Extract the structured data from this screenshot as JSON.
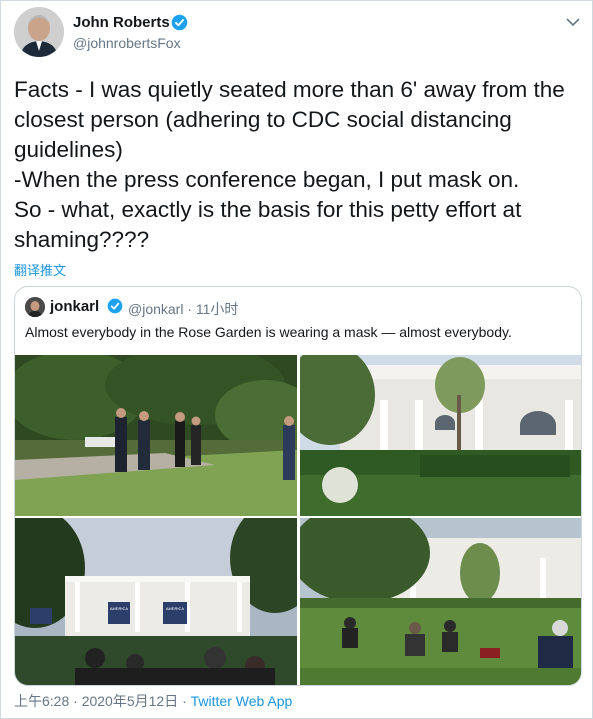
{
  "tweet": {
    "author_name": "John Roberts",
    "author_handle": "@johnrobertsFox",
    "text": "Facts - I was quietly seated more than 6' away from the\nclosest person (adhering to CDC social distancing\nguidelines)\n-When the press conference began, I put mask on.\nSo - what, exactly is the basis for this petty effort at\nshaming????",
    "translate_label": "翻译推文",
    "timestamp": "上午6:28 · 2020年5月12日 · ",
    "source_app": "Twitter Web App"
  },
  "quoted": {
    "author_name": "jonkarl",
    "author_handle": "@jonkarl · 11小时",
    "text": "Almost everybody in the Rose Garden is wearing a mask — almost everybody."
  },
  "photos": {
    "p3_banner_left": "AMERICA",
    "p3_banner_right": "AMERICA"
  },
  "colors": {
    "link_blue": "#1b95e0",
    "verified_blue": "#1da1f2",
    "secondary_gray": "#657786",
    "border": "#ccd6dd"
  },
  "icons": {
    "verified": "verified-badge-icon",
    "caret": "chevron-down-icon"
  }
}
